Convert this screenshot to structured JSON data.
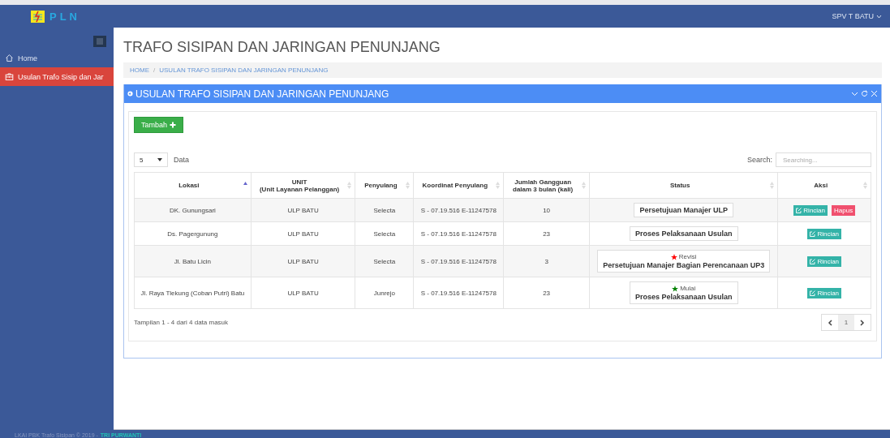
{
  "brand": {
    "name": "PLN"
  },
  "user_menu": {
    "label": "SPV T BATU"
  },
  "sidebar": {
    "items": [
      {
        "label": "Home",
        "selected": false
      },
      {
        "label": "Usulan Trafo Sisip dan Jar",
        "selected": true
      }
    ]
  },
  "page_title": "TRAFO SISIPAN DAN JARINGAN PENUNJANG",
  "breadcrumb": [
    "HOME",
    "/",
    "USULAN TRAFO SISIPAN DAN JARINGAN PENUNJANG"
  ],
  "panel": {
    "title": "USULAN TRAFO SISIPAN DAN JARINGAN PENUNJANG",
    "add_button": "Tambah",
    "page_size": "5",
    "page_size_label": "Data",
    "search": {
      "label": "Search:",
      "placeholder": "Searching..."
    },
    "table": {
      "columns": [
        {
          "label": "Lokasi",
          "sorted_ascending": true
        },
        {
          "label": "UNIT",
          "sublabel": "(Unit Layanan Pelanggan)",
          "sorted_ascending": false
        },
        {
          "label": "Penyulang",
          "sorted_ascending": false
        },
        {
          "label": "Koordinat Penyulang",
          "sorted_ascending": false
        },
        {
          "label": "Jumlah Gangguan",
          "sublabel": "dalam 3 bulan (kali)",
          "sorted_ascending": false
        },
        {
          "label": "Status",
          "sorted_ascending": false
        },
        {
          "label": "Aksi",
          "sorted_ascending": false
        }
      ],
      "rows": [
        {
          "lokasi": "DK. Gunungsari",
          "unit": "ULP BATU",
          "penyulang": "Selecta",
          "koordinat": "S - 07.19.516 E-11247578",
          "jumlah": "10",
          "status": {
            "text": "Persetujuan Manajer ULP"
          },
          "actions": [
            {
              "kind": "detail",
              "label": "Rincian"
            },
            {
              "kind": "delete",
              "label": "Hapus"
            }
          ]
        },
        {
          "lokasi": "Ds. Pagergunung",
          "unit": "ULP BATU",
          "penyulang": "Selecta",
          "koordinat": "S - 07.19.516 E-11247578",
          "jumlah": "23",
          "status": {
            "text": "Proses Pelaksanaan Usulan"
          },
          "actions": [
            {
              "kind": "detail",
              "label": "Rincian"
            }
          ]
        },
        {
          "lokasi": "Jl. Batu Licin",
          "unit": "ULP BATU",
          "penyulang": "Selecta",
          "koordinat": "S - 07.19.516 E-11247578",
          "jumlah": "3",
          "status": {
            "note": "Revisi",
            "color": "#ff0000",
            "text": "Persetujuan Manajer Bagian Perencanaan UP3"
          },
          "actions": [
            {
              "kind": "detail",
              "label": "Rincian"
            }
          ]
        },
        {
          "lokasi": "Jl. Raya Tlekung (Coban Putri) Batu",
          "unit": "ULP BATU",
          "penyulang": "Junrejo",
          "koordinat": "S - 07.19.516 E-11247578",
          "jumlah": "23",
          "status": {
            "note": "Mulai",
            "color": "#008000",
            "text": "Proses Pelaksanaan Usulan"
          },
          "actions": [
            {
              "kind": "detail",
              "label": "Rincian"
            }
          ]
        }
      ]
    },
    "info": "Tampilan 1 - 4 dari 4 data masuk",
    "pagination": {
      "pages": [
        {
          "label": "1",
          "selected": true
        }
      ]
    }
  },
  "footer": {
    "text": "LKAI PBK Trafo Sisipan © 2019 -",
    "author": "TRI PURWANTI"
  }
}
